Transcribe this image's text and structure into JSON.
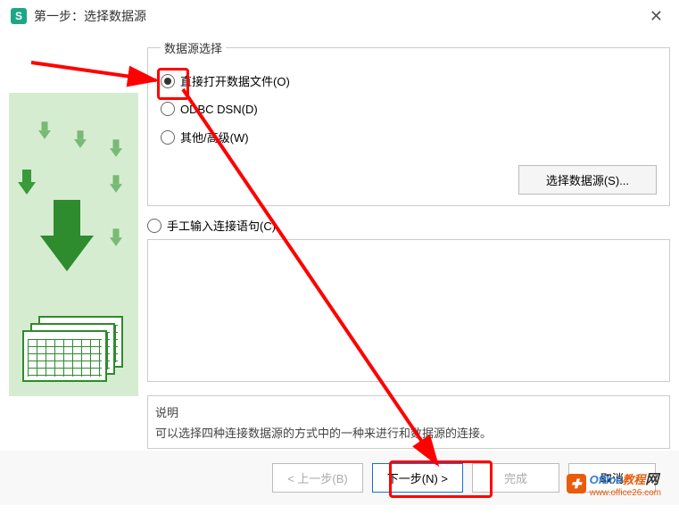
{
  "titlebar": {
    "app_icon_letter": "S",
    "title": "第一步：选择数据源"
  },
  "group": {
    "legend": "数据源选择",
    "options": [
      {
        "label": "直接打开数据文件(O)",
        "checked": true
      },
      {
        "label": "ODBC DSN(D)",
        "checked": false
      },
      {
        "label": "其他/高级(W)",
        "checked": false
      }
    ],
    "select_button": "选择数据源(S)..."
  },
  "manual": {
    "label": "手工输入连接语句(C)",
    "value": ""
  },
  "description": {
    "title": "说明",
    "text": "可以选择四种连接数据源的方式中的一种来进行和数据源的连接。"
  },
  "footer": {
    "prev": "< 上一步(B)",
    "next": "下一步(N) >",
    "finish": "完成",
    "cancel": "取消"
  },
  "watermark": {
    "brand_prefix": "Office",
    "brand_suffix": "教程",
    "brand_cn": "网",
    "url": "www.office26.com"
  }
}
